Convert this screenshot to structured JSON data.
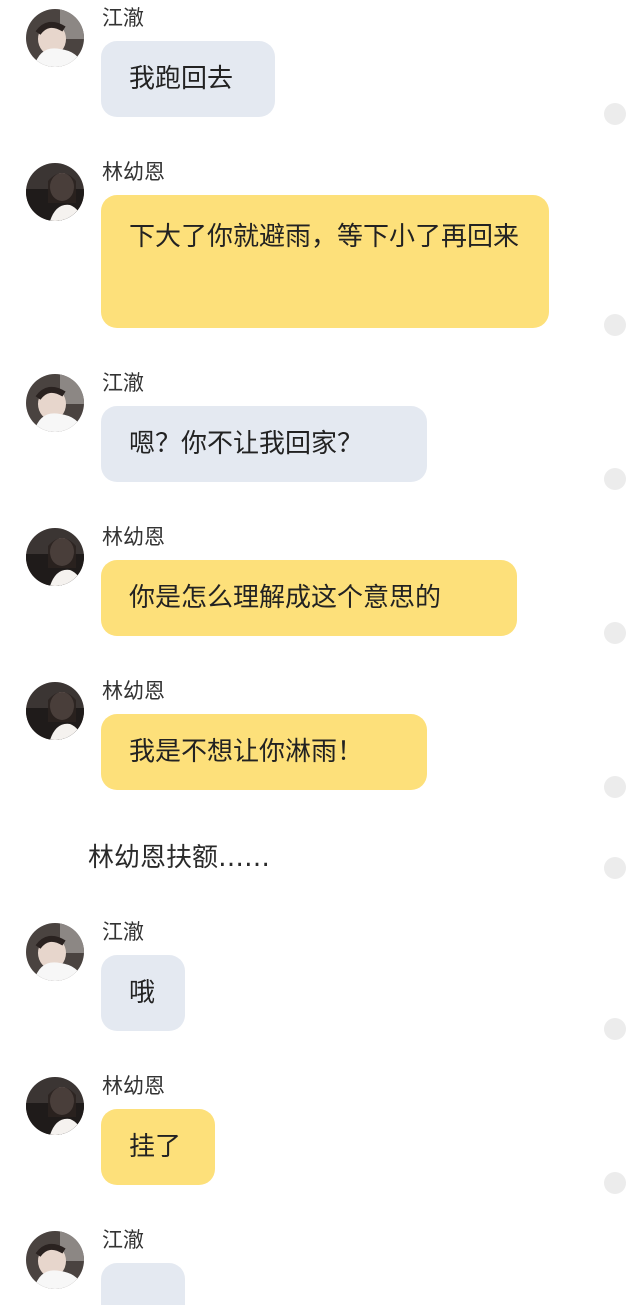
{
  "messages": [
    {
      "sender": "江澈",
      "text": "我跑回去",
      "avatar": "boy-avatar-icon"
    },
    {
      "sender": "林幼恩",
      "text": "下大了你就避雨，等下小了再回来",
      "avatar": "girl-avatar-icon"
    },
    {
      "sender": "江澈",
      "text": "嗯？你不让我回家？",
      "avatar": "boy-avatar-icon"
    },
    {
      "sender": "林幼恩",
      "text": "你是怎么理解成这个意思的",
      "avatar": "girl-avatar-icon"
    },
    {
      "sender": "林幼恩",
      "text": "我是不想让你淋雨！",
      "avatar": "girl-avatar-icon"
    },
    {
      "sender": "江澈",
      "text": "哦",
      "avatar": "boy-avatar-icon"
    },
    {
      "sender": "林幼恩",
      "text": "挂了",
      "avatar": "girl-avatar-icon"
    },
    {
      "sender": "江澈",
      "text": "",
      "avatar": "boy-avatar-icon"
    }
  ],
  "narration": "林幼恩扶额……",
  "colors": {
    "jiangche_bubble": "#e4e9f1",
    "linyouen_bubble": "#fde07a",
    "side_dot": "#ececec"
  }
}
